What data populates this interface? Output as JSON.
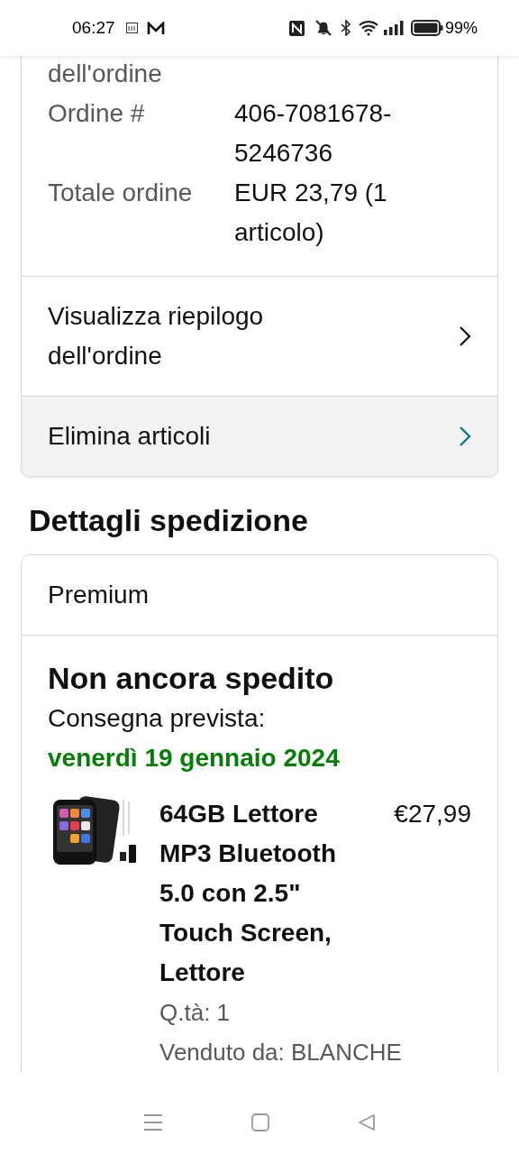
{
  "status_bar": {
    "time": "06:27",
    "battery": "99%"
  },
  "order_summary": {
    "fields": [
      {
        "label": "dell'ordine"
      },
      {
        "label": "Ordine #",
        "value": "406-7081678-5246736"
      },
      {
        "label": "Totale ordine",
        "value": "EUR 23,79 (1 articolo)"
      }
    ],
    "links": [
      {
        "label": "Visualizza riepilogo dell'ordine",
        "highlighted": false
      },
      {
        "label": "Elimina articoli",
        "highlighted": true
      }
    ]
  },
  "shipping": {
    "title": "Dettagli spedizione",
    "service": "Premium",
    "status": "Non ancora spedito",
    "delivery_label": "Consegna prevista:",
    "delivery_date": "venerdì 19 gennaio 2024",
    "items": [
      {
        "title": "64GB Lettore MP3 Bluetooth 5.0 con 2.5\" Touch Screen, Lettore",
        "price": "€27,99",
        "quantity": "Q.tà: 1",
        "seller": "Venduto da: BLANCHE"
      }
    ]
  }
}
